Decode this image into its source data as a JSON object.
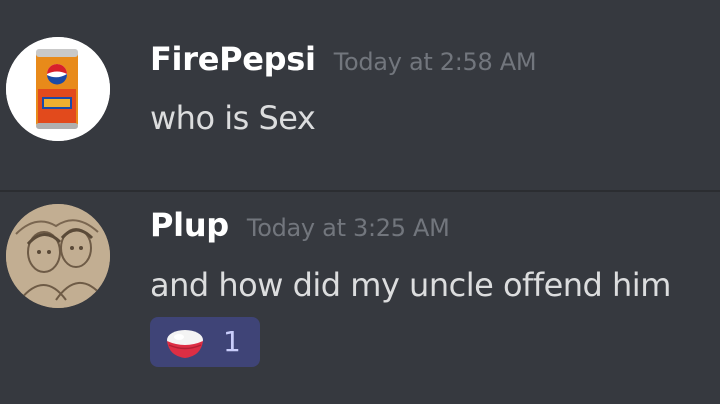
{
  "messages": [
    {
      "username": "FirePepsi",
      "timestamp": "Today at 2:58 AM",
      "content": "who is Sex",
      "avatar": "pepsi-fire-can"
    },
    {
      "username": "Plup",
      "timestamp": "Today at 3:25 AM",
      "content": "and how did my uncle offend him",
      "avatar": "sketch-drawing",
      "reaction": {
        "emoji": "rice-bowl",
        "count": "1"
      }
    }
  ],
  "colors": {
    "background": "#36393f",
    "username": "#ffffff",
    "timestamp": "#72767d",
    "message_text": "#dcddde",
    "reaction_bg": "#3f4477",
    "reaction_count": "#c9cdfb"
  }
}
